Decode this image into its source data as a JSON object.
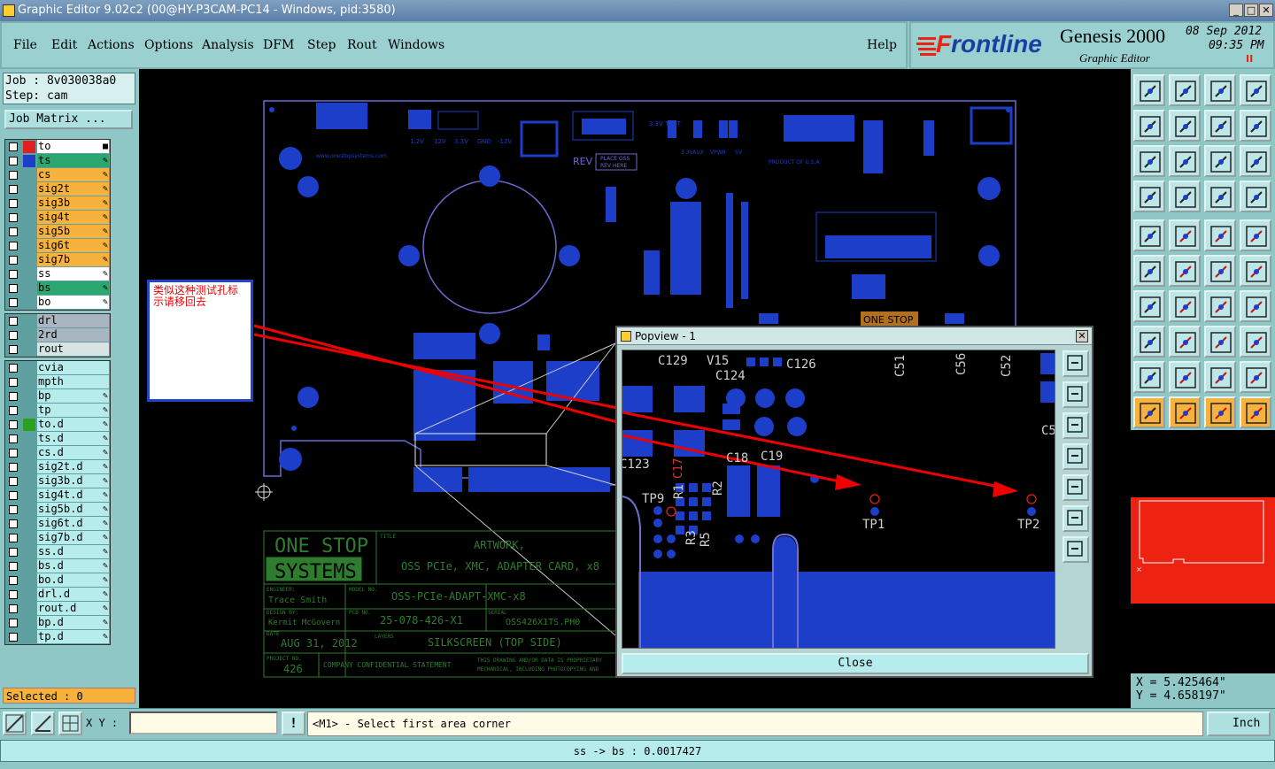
{
  "title_bar": {
    "text": "Graphic Editor 9.02c2 (00@HY-P3CAM-PC14 - Windows, pid:3580)",
    "btn_min": "_",
    "btn_max": "□",
    "btn_close": "✕"
  },
  "menu": {
    "file": "File",
    "edit": "Edit",
    "actions": "Actions",
    "options": "Options",
    "analysis": "Analysis",
    "dfm": "DFM",
    "step": "Step",
    "rout": "Rout",
    "windows": "Windows",
    "help": "Help"
  },
  "brand": {
    "logo_prefix": "F",
    "logo_rest": "rontline",
    "product": "Genesis 2000",
    "subtitle": "Graphic Editor",
    "date": "08 Sep 2012",
    "time": "09:35 PM",
    "pause": "II"
  },
  "job": {
    "job_line": "Job : 8v030038a0",
    "step_line": "Step: cam",
    "matrix_button": "Job Matrix ..."
  },
  "layers_group1": [
    {
      "name": "to",
      "color": "#ffffff",
      "swatch": "#e02020",
      "mark": "■"
    },
    {
      "name": "ts",
      "color": "#2aa870",
      "swatch": "#1d3ec8",
      "mark": "✎"
    },
    {
      "name": "cs",
      "color": "#f6b23c",
      "swatch": "#5fa0a0",
      "mark": "✎"
    },
    {
      "name": "sig2t",
      "color": "#f6b23c",
      "swatch": "#5fa0a0",
      "mark": "✎"
    },
    {
      "name": "sig3b",
      "color": "#f6b23c",
      "swatch": "#5fa0a0",
      "mark": "✎"
    },
    {
      "name": "sig4t",
      "color": "#f6b23c",
      "swatch": "#5fa0a0",
      "mark": "✎"
    },
    {
      "name": "sig5b",
      "color": "#f6b23c",
      "swatch": "#5fa0a0",
      "mark": "✎"
    },
    {
      "name": "sig6t",
      "color": "#f6b23c",
      "swatch": "#5fa0a0",
      "mark": "✎"
    },
    {
      "name": "sig7b",
      "color": "#f6b23c",
      "swatch": "#5fa0a0",
      "mark": "✎"
    },
    {
      "name": "ss",
      "color": "#ffffff",
      "swatch": "#5fa0a0",
      "mark": "✎"
    },
    {
      "name": "bs",
      "color": "#2aa870",
      "swatch": "#5fa0a0",
      "mark": "✎"
    },
    {
      "name": "bo",
      "color": "#ffffff",
      "swatch": "#5fa0a0",
      "mark": "✎"
    }
  ],
  "layers_group2": [
    {
      "name": "drl",
      "color": "#a9b6c2",
      "swatch": "#5fa0a0",
      "mark": ""
    },
    {
      "name": "2rd",
      "color": "#a9b6c2",
      "swatch": "#5fa0a0",
      "mark": ""
    },
    {
      "name": "rout",
      "color": "#d8e4e4",
      "swatch": "#5fa0a0",
      "mark": ""
    }
  ],
  "layers_group3": [
    {
      "name": "cvia",
      "color": "#b6ecec",
      "swatch": "#5fa0a0",
      "mark": ""
    },
    {
      "name": "mpth",
      "color": "#b6ecec",
      "swatch": "#5fa0a0",
      "mark": ""
    },
    {
      "name": "bp",
      "color": "#b6ecec",
      "swatch": "#5fa0a0",
      "mark": "✎"
    },
    {
      "name": "tp",
      "color": "#b6ecec",
      "swatch": "#5fa0a0",
      "mark": "✎"
    },
    {
      "name": "to.d",
      "color": "#b6ecec",
      "swatch": "#2aa020",
      "mark": "✎"
    },
    {
      "name": "ts.d",
      "color": "#b6ecec",
      "swatch": "#5fa0a0",
      "mark": "✎"
    },
    {
      "name": "cs.d",
      "color": "#b6ecec",
      "swatch": "#5fa0a0",
      "mark": "✎"
    },
    {
      "name": "sig2t.d",
      "color": "#b6ecec",
      "swatch": "#5fa0a0",
      "mark": "✎"
    },
    {
      "name": "sig3b.d",
      "color": "#b6ecec",
      "swatch": "#5fa0a0",
      "mark": "✎"
    },
    {
      "name": "sig4t.d",
      "color": "#b6ecec",
      "swatch": "#5fa0a0",
      "mark": "✎"
    },
    {
      "name": "sig5b.d",
      "color": "#b6ecec",
      "swatch": "#5fa0a0",
      "mark": "✎"
    },
    {
      "name": "sig6t.d",
      "color": "#b6ecec",
      "swatch": "#5fa0a0",
      "mark": "✎"
    },
    {
      "name": "sig7b.d",
      "color": "#b6ecec",
      "swatch": "#5fa0a0",
      "mark": "✎"
    },
    {
      "name": "ss.d",
      "color": "#b6ecec",
      "swatch": "#5fa0a0",
      "mark": "✎"
    },
    {
      "name": "bs.d",
      "color": "#b6ecec",
      "swatch": "#5fa0a0",
      "mark": "✎"
    },
    {
      "name": "bo.d",
      "color": "#b6ecec",
      "swatch": "#5fa0a0",
      "mark": "✎"
    },
    {
      "name": "drl.d",
      "color": "#b6ecec",
      "swatch": "#5fa0a0",
      "mark": "✎"
    },
    {
      "name": "rout.d",
      "color": "#b6ecec",
      "swatch": "#5fa0a0",
      "mark": "✎"
    },
    {
      "name": "bp.d",
      "color": "#b6ecec",
      "swatch": "#5fa0a0",
      "mark": "✎"
    },
    {
      "name": "tp.d",
      "color": "#b6ecec",
      "swatch": "#5fa0a0",
      "mark": "✎"
    }
  ],
  "selected": "Selected : 0",
  "note": "类似这种测试孔标示请移回去",
  "board": {
    "website": "www.onestopsystems.com",
    "rev": "REV",
    "place_oss": "PLACE OSS",
    "rev_here": "REV HERE",
    "v33trst": "3.3V TRST",
    "v33aux": "3.3VAUX",
    "vpwr": "VPWR",
    "v5": "5V",
    "product_of": "PRODUCT OF U.S.A.",
    "onestop_logo": "ONE STOP",
    "volts": [
      "1.2V",
      "12V",
      "3.3V",
      "GND",
      "-12V"
    ],
    "tb_logo1": "ONE STOP",
    "tb_logo2": "SYSTEMS",
    "tb_title_lbl": "TITLE",
    "tb_title1": "ARTWORK,",
    "tb_title2": "OSS PCIe, XMC, ADAPTER CARD, x8",
    "tb_eng_lbl": "ENGINEER:",
    "tb_eng": "Trace Smith",
    "tb_model_lbl": "MODEL NO.",
    "tb_model": "OSS-PCIe-ADAPT-XMC-x8",
    "tb_design_lbl": "DESIGN BY:",
    "tb_design": "Kermit McGovern",
    "tb_pcb_lbl": "PCB NO.",
    "tb_pcb": "25-078-426-X1",
    "tb_serial_lbl": "SERIAL",
    "tb_serial": "OSS426X1TS.PH0",
    "tb_date_lbl": "DATE",
    "tb_date": "AUG 31, 2012",
    "tb_layer_lbl": "LAYERS",
    "tb_layer": "SILKSCREEN (TOP SIDE)",
    "tb_proj_lbl": "PROJECT NO.",
    "tb_proj": "426",
    "tb_conf": "COMPANY CONFIDENTIAL STATEMENT",
    "tb_conf2": "THIS DRAWING AND/OR DATA IS PROPRIETARY",
    "tb_conf3": "MECHANICAL, INCLUDING PHOTOCOPYING AND"
  },
  "popview": {
    "title": "Popview - 1",
    "close_x": "✕",
    "close_button": "Close",
    "labels": {
      "c129": "C129",
      "v15": "V15",
      "c124": "C124",
      "c126": "C126",
      "c51": "C51",
      "c56": "C56",
      "c52": "C52",
      "c123": "C123",
      "c17": "C17",
      "c18": "C18",
      "c19": "C19",
      "c5": "C5",
      "tp9": "TP9",
      "r1": "R1",
      "r2": "R2",
      "r3": "R3",
      "r5": "R5",
      "tp1": "TP1",
      "tp2": "TP2"
    }
  },
  "coords": {
    "x": "X  =  5.425464\"",
    "y": "Y  =  4.658197\""
  },
  "bottom": {
    "xy_label": "X Y :",
    "xy_value": "",
    "prompt_icon": "!",
    "prompt": "<M1> - Select first area corner",
    "unit": "Inch"
  },
  "status": "ss -> bs : 0.0017427",
  "colors": {
    "panel": "#8fc7c7",
    "board_blue": "#1d3ec8",
    "silk_green": "#2e7d2e",
    "annotation_red": "#e00000",
    "outline_purple": "#7070c0"
  }
}
